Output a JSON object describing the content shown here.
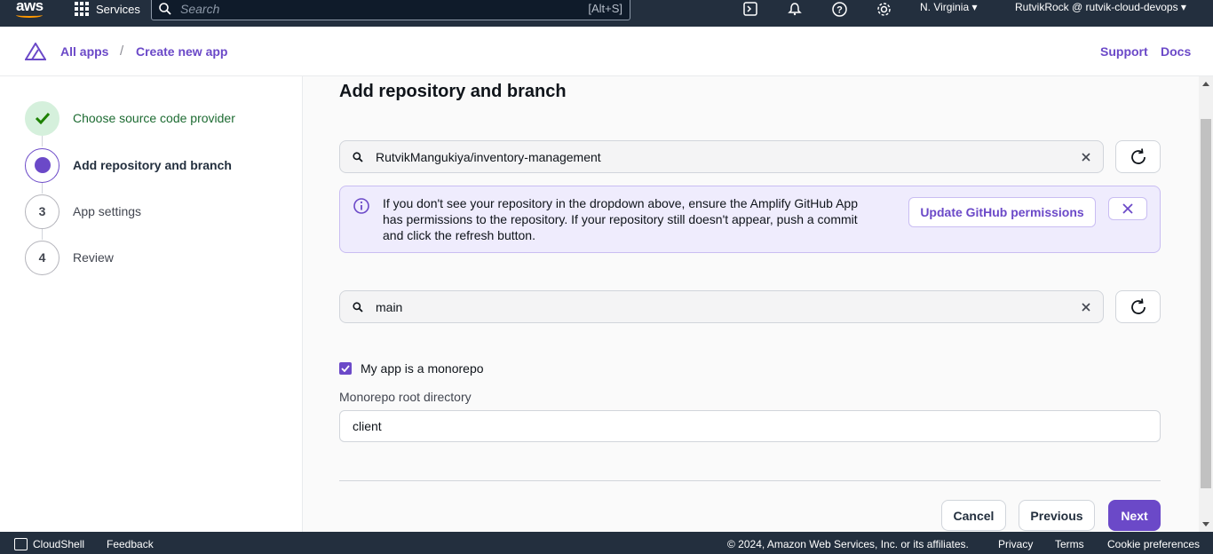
{
  "topnav": {
    "logo": "aws",
    "services_label": "Services",
    "search_placeholder": "Search",
    "search_shortcut": "[Alt+S]",
    "region": "N. Virginia ▾",
    "account": "RutvikRock @ rutvik-cloud-devops ▾"
  },
  "header": {
    "breadcrumb": [
      "All apps",
      "Create new app"
    ],
    "separator": "/",
    "support": "Support",
    "docs": "Docs"
  },
  "steps": [
    {
      "number": "",
      "label": "Choose source code provider",
      "state": "done"
    },
    {
      "number": "",
      "label": "Add repository and branch",
      "state": "active"
    },
    {
      "number": "3",
      "label": "App settings",
      "state": "pending"
    },
    {
      "number": "4",
      "label": "Review",
      "state": "pending"
    }
  ],
  "main": {
    "title": "Add repository and branch",
    "repository_value": "RutvikMangukiya/inventory-management",
    "alert_text": "If you don't see your repository in the dropdown above, ensure the Amplify GitHub App has permissions to the repository. If your repository still doesn't appear, push a commit and click the refresh button.",
    "github_button": "Update GitHub permissions",
    "branch_value": "main",
    "monorepo_label": "My app is a monorepo",
    "monorepo_checked": true,
    "root_dir_label": "Monorepo root directory",
    "root_dir_value": "client",
    "cancel": "Cancel",
    "previous": "Previous",
    "next": "Next"
  },
  "footer": {
    "cloudshell": "CloudShell",
    "feedback": "Feedback",
    "copyright": "© 2024, Amazon Web Services, Inc. or its affiliates.",
    "privacy": "Privacy",
    "terms": "Terms",
    "cookies": "Cookie preferences"
  },
  "colors": {
    "accent": "#6b49c8",
    "nav_bg": "#232f3e",
    "done_bg": "#d5f0dc",
    "alert_bg": "#efecfd"
  }
}
